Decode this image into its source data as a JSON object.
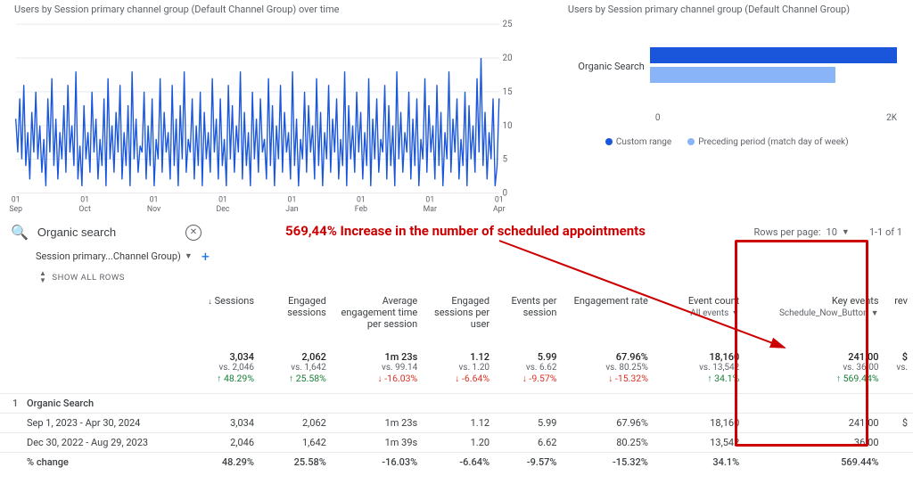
{
  "chart_data": [
    {
      "type": "line",
      "title": "Users by Session primary channel group (Default Channel Group) over time",
      "xlabel": "",
      "ylabel": "",
      "ylim": [
        0,
        25
      ],
      "y_ticks": [
        0,
        5,
        10,
        15,
        20,
        25
      ],
      "x_categories": [
        "01 Sep",
        "01 Oct",
        "01 Nov",
        "01 Dec",
        "01 Jan",
        "01 Feb",
        "01 Mar",
        "01 Apr"
      ],
      "series": [
        {
          "name": "Organic Search (Custom range)",
          "color": "#1a56db",
          "values": [
            11,
            6,
            14,
            5,
            16,
            4,
            9,
            2,
            12,
            6,
            15,
            5,
            10,
            3,
            8,
            1,
            14,
            6,
            17,
            4,
            11,
            2,
            9,
            5,
            13,
            3,
            16,
            6,
            10,
            4,
            18,
            2,
            7,
            1,
            13,
            5,
            9,
            3,
            15,
            6,
            11,
            2,
            8,
            4,
            14,
            1,
            17,
            5,
            10,
            3,
            12,
            6,
            16,
            2,
            9,
            4,
            13,
            1,
            18,
            5,
            11,
            3,
            7,
            6,
            15,
            2,
            10,
            4,
            14,
            1,
            8,
            5,
            17,
            3,
            12,
            6,
            9,
            2,
            16,
            4,
            11,
            1,
            13,
            5,
            18,
            3,
            8,
            6,
            14,
            2,
            10,
            4,
            15,
            1,
            12,
            5,
            9,
            3,
            17,
            6,
            11,
            2,
            14,
            4,
            8,
            1,
            16,
            5,
            13,
            3,
            10,
            6,
            18,
            2,
            12,
            4,
            9,
            1,
            15,
            5,
            11,
            3,
            14,
            6,
            8,
            2,
            17,
            4,
            13,
            1,
            10,
            5,
            16,
            3,
            12,
            6,
            9,
            2,
            18,
            4,
            11,
            1,
            8,
            5,
            15,
            3,
            13,
            6,
            10,
            2,
            17,
            4,
            12,
            1,
            9,
            5,
            16,
            3,
            11,
            6,
            14,
            2,
            8,
            4,
            18,
            1,
            13,
            5,
            10,
            3,
            15,
            6,
            12,
            2,
            9,
            4,
            17,
            1,
            11,
            5,
            14,
            3,
            8,
            6,
            16,
            2,
            13,
            4,
            10,
            1,
            18,
            5,
            12,
            3,
            9,
            6,
            15,
            2,
            11,
            4,
            14,
            1,
            8,
            5,
            17,
            3,
            13,
            6,
            10,
            2,
            16,
            4,
            12,
            1,
            9,
            5,
            18,
            3,
            11,
            6,
            14,
            2,
            8,
            4,
            15,
            1,
            13,
            5,
            10,
            3,
            17,
            6,
            20,
            4,
            12,
            2,
            9,
            5,
            14,
            1,
            4,
            14
          ]
        }
      ]
    },
    {
      "type": "bar",
      "title": "Users by Session primary channel group (Default Channel Group)",
      "orientation": "horizontal",
      "categories": [
        "Organic Search"
      ],
      "series": [
        {
          "name": "Custom range",
          "color": "#1a56db",
          "values": [
            1900
          ]
        },
        {
          "name": "Preceding period (match day of week)",
          "color": "#8ab4f8",
          "values": [
            1400
          ]
        }
      ],
      "xlim": [
        0,
        2000
      ],
      "x_ticks": [
        "0",
        "2K"
      ]
    }
  ],
  "bar_axis_min": "0",
  "bar_axis_max": "2K",
  "legend_custom": "Custom range",
  "legend_preceding": "Preceding period (match day of week)",
  "bar_label_organic": "Organic Search",
  "line_title": "Users by Session primary channel group (Default Channel Group) over time",
  "bar_title": "Users by Session primary channel group (Default Channel Group)",
  "annotation": "569,44% Increase in the number of scheduled appointments",
  "search_value": "Organic search",
  "rows_per_page_label": "Rows per page:",
  "rows_per_page_value": "10",
  "page_info": "1-1 of 1",
  "dim_label": "Session primary...Channel Group)",
  "show_all": "SHOW ALL ROWS",
  "col": {
    "sessions": "Sessions",
    "engaged": "Engaged sessions",
    "avgtime": "Average engagement time per session",
    "engperuser": "Engaged sessions per user",
    "evpersess": "Events per session",
    "engrate": "Engagement rate",
    "evcount": "Event count",
    "evcount_sub": "All events",
    "keyevents": "Key events",
    "keyevents_sub": "Schedule_Now_Button",
    "rev": "rev"
  },
  "totals": {
    "sessions": {
      "v": "3,034",
      "vs": "vs. 2,046",
      "d": "↑ 48.29%",
      "dir": "up"
    },
    "engaged": {
      "v": "2,062",
      "vs": "vs. 1,642",
      "d": "↑ 25.58%",
      "dir": "up"
    },
    "avgtime": {
      "v": "1m 23s",
      "vs": "vs. 99.14",
      "d": "↓ -16.03%",
      "dir": "dn"
    },
    "engperuser": {
      "v": "1.12",
      "vs": "vs. 1.20",
      "d": "↓ -6.64%",
      "dir": "dn"
    },
    "evpersess": {
      "v": "5.99",
      "vs": "vs. 6.62",
      "d": "↓ -9.57%",
      "dir": "dn"
    },
    "engrate": {
      "v": "67.96%",
      "vs": "vs. 80.25%",
      "d": "↓ -15.32%",
      "dir": "dn"
    },
    "evcount": {
      "v": "18,160",
      "vs": "vs. 13,542",
      "d": "↑ 34.1%",
      "dir": "up"
    },
    "keyevents": {
      "v": "241.00",
      "vs": "vs. 36.00",
      "d": "↑ 569.44%",
      "dir": "up"
    },
    "rev": {
      "v": "$",
      "vs": "vs.",
      "d": "",
      "dir": ""
    }
  },
  "rows": [
    {
      "idx": "1",
      "label": "Organic Search",
      "cells": [
        "",
        "",
        "",
        "",
        "",
        "",
        "",
        "",
        ""
      ]
    },
    {
      "idx": "",
      "label": "Sep 1, 2023 - Apr 30, 2024",
      "cells": [
        "3,034",
        "2,062",
        "1m 23s",
        "1.12",
        "5.99",
        "67.96%",
        "18,160",
        "241.00",
        "$"
      ]
    },
    {
      "idx": "",
      "label": "Dec 30, 2022 - Aug 29, 2023",
      "cells": [
        "2,046",
        "1,642",
        "1m 39s",
        "1.20",
        "6.62",
        "80.25%",
        "13,542",
        "36.00",
        ""
      ]
    },
    {
      "idx": "",
      "label": "% change",
      "cells": [
        "48.29%",
        "25.58%",
        "-16.03%",
        "-6.64%",
        "-9.57%",
        "-15.32%",
        "34.1%",
        "569.44%",
        ""
      ]
    }
  ],
  "x_ticks_line": [
    {
      "t1": "01",
      "t2": "Sep"
    },
    {
      "t1": "01",
      "t2": "Oct"
    },
    {
      "t1": "01",
      "t2": "Nov"
    },
    {
      "t1": "01",
      "t2": "Dec"
    },
    {
      "t1": "01",
      "t2": "Jan"
    },
    {
      "t1": "01",
      "t2": "Feb"
    },
    {
      "t1": "01",
      "t2": "Mar"
    },
    {
      "t1": "01",
      "t2": "Apr"
    }
  ],
  "y_ticks_line": [
    "0",
    "5",
    "10",
    "15",
    "20",
    "25"
  ]
}
